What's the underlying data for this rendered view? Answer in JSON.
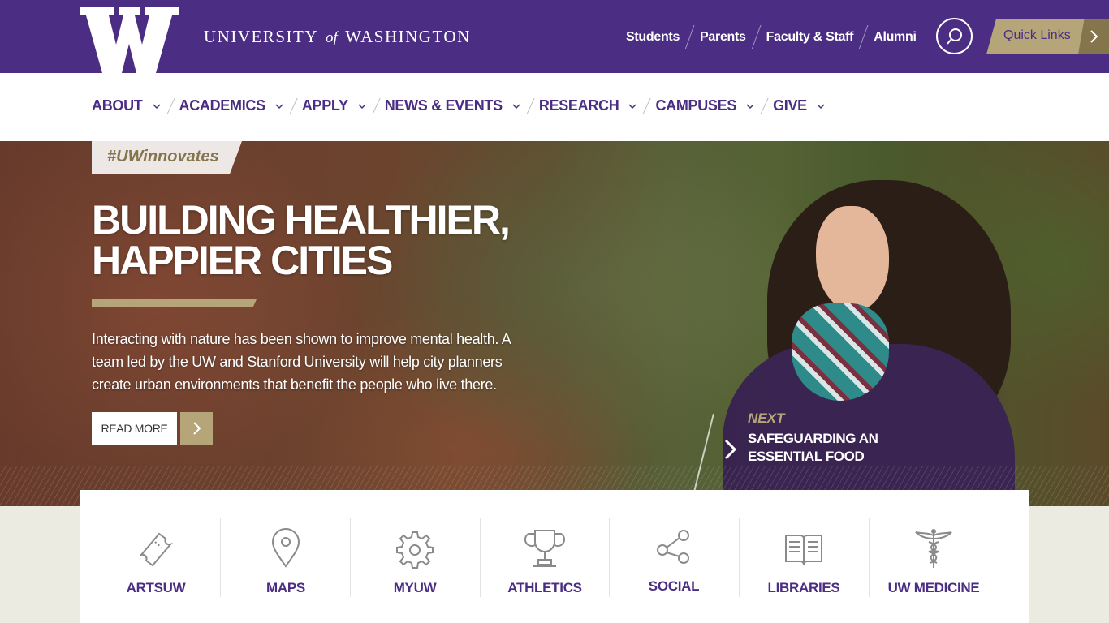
{
  "header": {
    "wordmark": {
      "pre": "UNIVERSITY",
      "of": "of",
      "post": "WASHINGTON"
    },
    "audience_links": [
      "Students",
      "Parents",
      "Faculty & Staff",
      "Alumni"
    ],
    "search_icon": "search-icon",
    "quick_links_label": "Quick Links"
  },
  "nav": {
    "items": [
      "ABOUT",
      "ACADEMICS",
      "APPLY",
      "NEWS & EVENTS",
      "RESEARCH",
      "CAMPUSES",
      "GIVE"
    ]
  },
  "hero": {
    "tag": "#UWinnovates",
    "title": "BUILDING HEALTHIER, HAPPIER CITIES",
    "description": "Interacting with nature has been shown to improve mental health. A team led by the UW and Stanford University will help city planners create urban environments that benefit the people who live there.",
    "read_more": "READ MORE",
    "next_label": "NEXT",
    "next_title": "SAFEGUARDING AN ESSENTIAL FOOD"
  },
  "tiles": [
    {
      "label": "ARTSUW",
      "icon": "ticket-icon"
    },
    {
      "label": "MAPS",
      "icon": "map-pin-icon"
    },
    {
      "label": "MYUW",
      "icon": "gear-icon"
    },
    {
      "label": "ATHLETICS",
      "icon": "trophy-icon"
    },
    {
      "label": "SOCIAL",
      "icon": "share-icon"
    },
    {
      "label": "LIBRARIES",
      "icon": "book-icon"
    },
    {
      "label": "UW MEDICINE",
      "icon": "caduceus-icon"
    }
  ],
  "colors": {
    "purple": "#4b2e83",
    "gold": "#b7a57a",
    "dark_gold": "#85754d"
  }
}
